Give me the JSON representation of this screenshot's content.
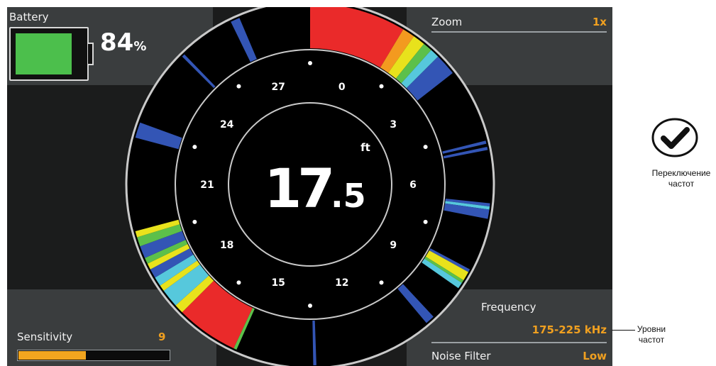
{
  "battery": {
    "title": "Battery",
    "percent": "84",
    "unit": "%",
    "level": 0.84,
    "color": "#4cbf4c"
  },
  "zoom": {
    "title": "Zoom",
    "value": "1x"
  },
  "sensitivity": {
    "title": "Sensitivity",
    "value": "9",
    "level": 0.45,
    "color": "#f2a51f"
  },
  "frequency": {
    "title": "Frequency",
    "value": "175-225 kHz"
  },
  "noise_filter": {
    "title": "Noise Filter",
    "value": "Low"
  },
  "depth": {
    "value": "17",
    "decimal": ".5",
    "unit": "ft"
  },
  "dial_labels": [
    "0",
    "3",
    "6",
    "9",
    "12",
    "15",
    "18",
    "21",
    "24",
    "27"
  ],
  "callouts": {
    "toggle": "Переключение частот",
    "levels": "Уровни частот"
  },
  "colors": {
    "accent": "#f0a020",
    "panel": "#3a3d3e",
    "screen": "#1b1c1c",
    "red": "#ea2a2a",
    "blue": "#3355b5"
  }
}
